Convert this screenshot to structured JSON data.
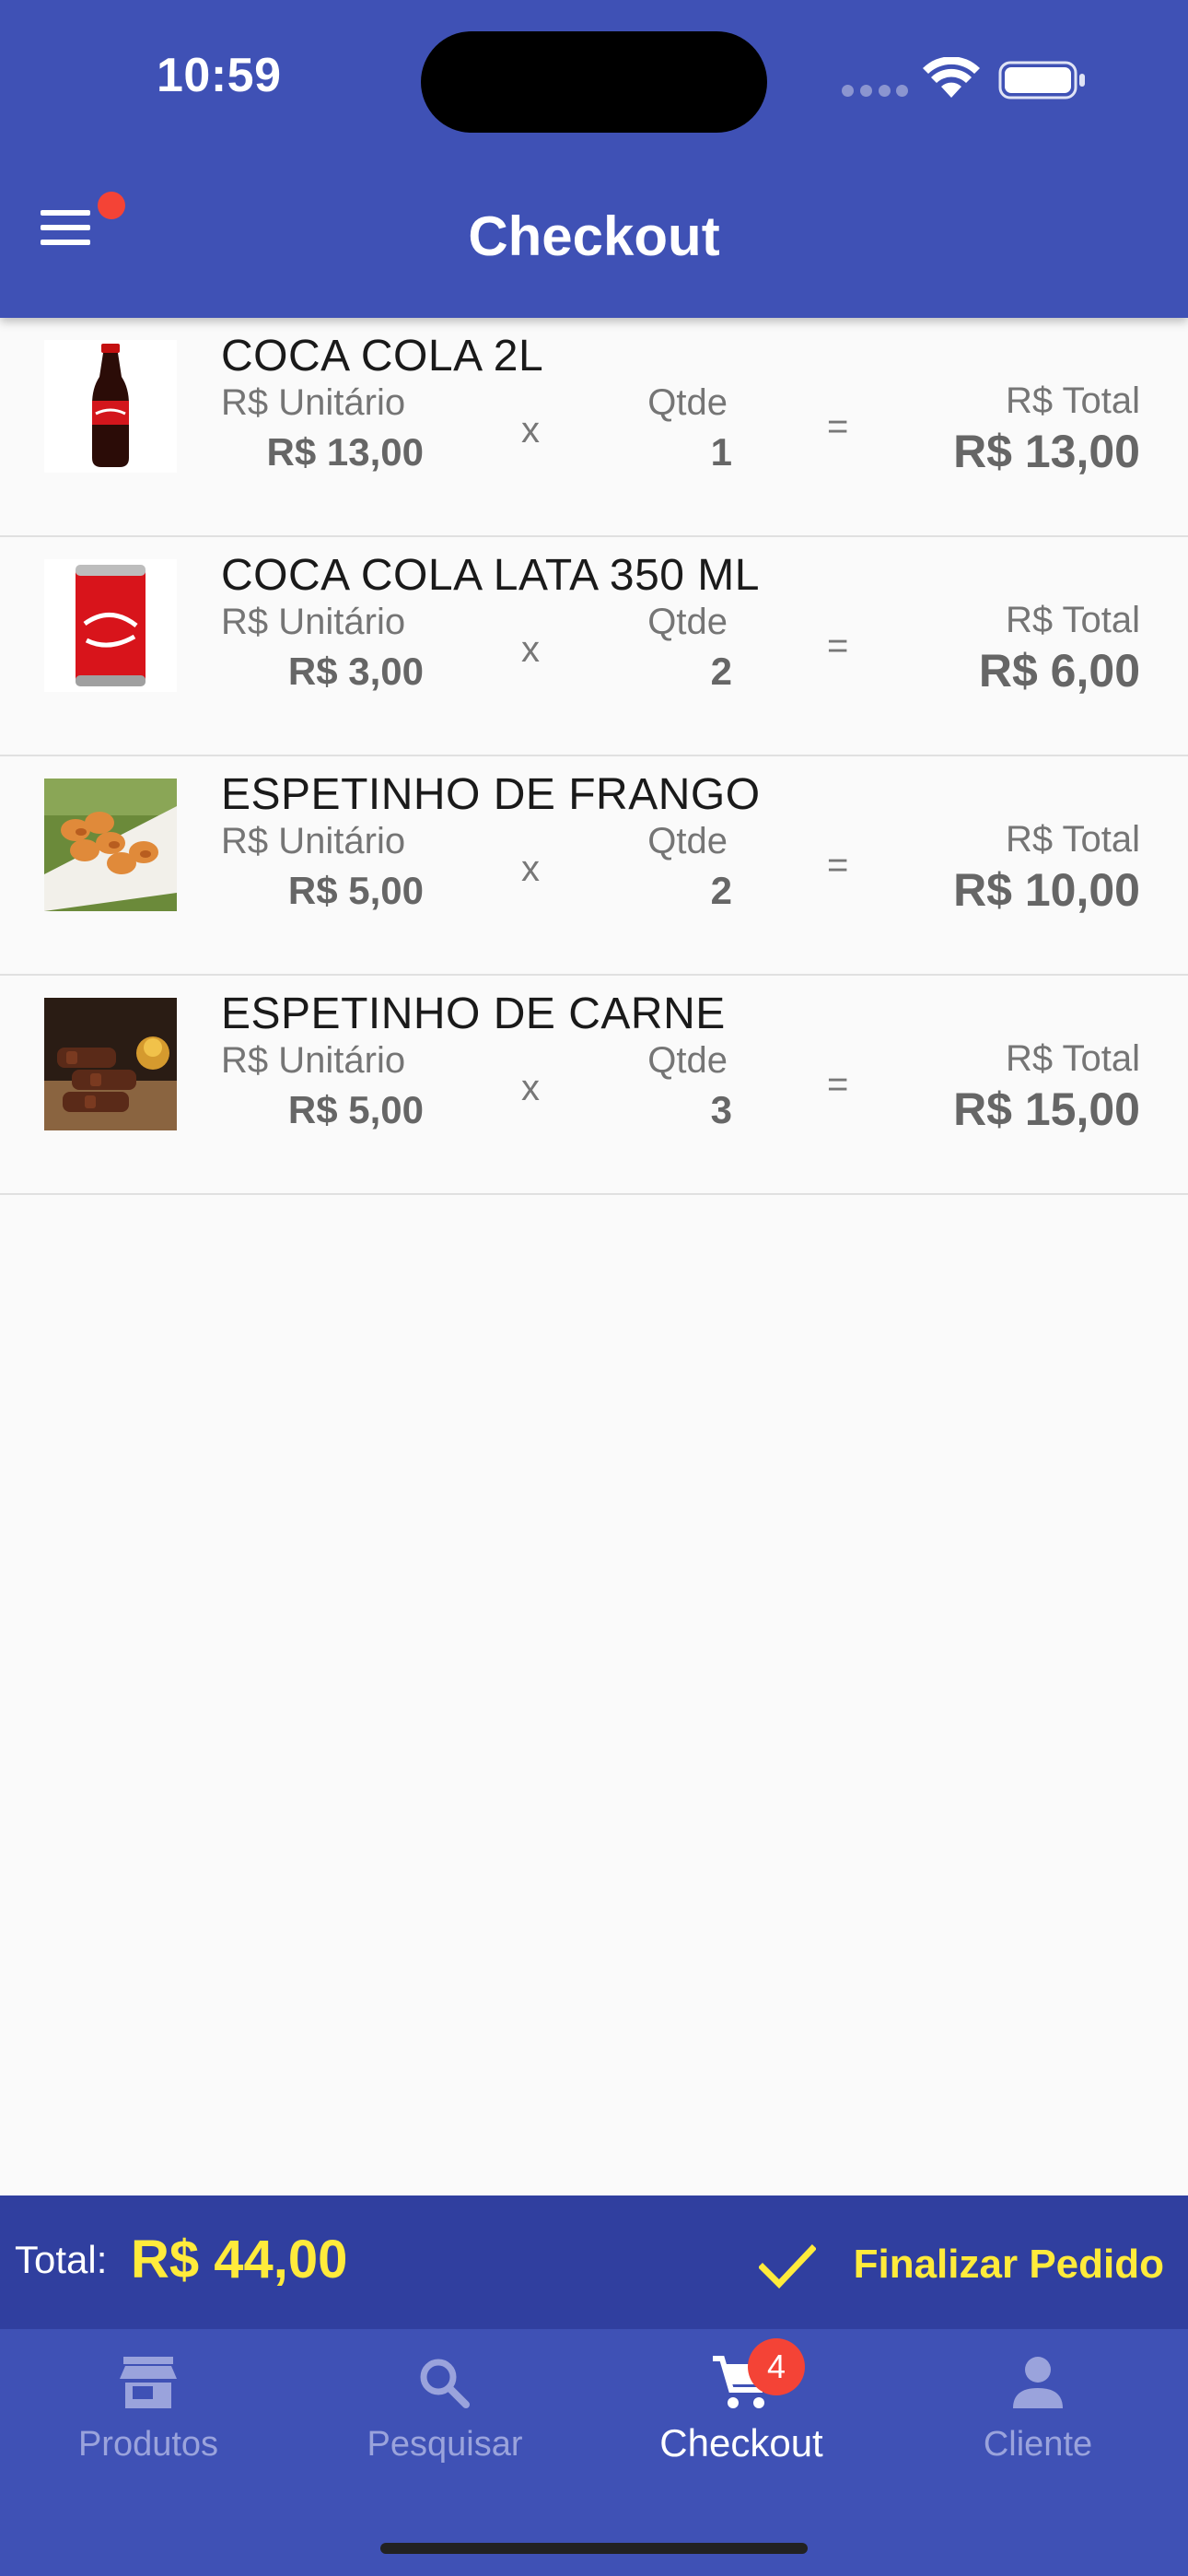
{
  "status_bar": {
    "time": "10:59"
  },
  "header": {
    "title": "Checkout",
    "menu_notification": true
  },
  "labels": {
    "unit_price": "R$ Unitário",
    "qty": "Qtde",
    "total": "R$ Total",
    "times": "x",
    "equals": "="
  },
  "items": [
    {
      "name": "COCA COLA 2L",
      "unit_price": "R$ 13,00",
      "qty": "1",
      "total": "R$ 13,00",
      "image": "coca-cola-2l-bottle"
    },
    {
      "name": "COCA COLA LATA 350 ML",
      "unit_price": "R$ 3,00",
      "qty": "2",
      "total": "R$ 6,00",
      "image": "coca-cola-can"
    },
    {
      "name": "ESPETINHO DE FRANGO",
      "unit_price": "R$ 5,00",
      "qty": "2",
      "total": "R$ 10,00",
      "image": "chicken-skewers"
    },
    {
      "name": "ESPETINHO DE CARNE",
      "unit_price": "R$ 5,00",
      "qty": "3",
      "total": "R$ 15,00",
      "image": "beef-skewers"
    }
  ],
  "footer": {
    "total_label": "Total:",
    "total_value": "R$ 44,00",
    "finalize_label": "Finalizar Pedido"
  },
  "bottom_nav": {
    "items": [
      {
        "label": "Produtos",
        "icon": "store-icon"
      },
      {
        "label": "Pesquisar",
        "icon": "search-icon"
      },
      {
        "label": "Checkout",
        "icon": "cart-icon",
        "active": true
      },
      {
        "label": "Cliente",
        "icon": "person-icon"
      }
    ],
    "cart_badge": "4"
  },
  "colors": {
    "primary": "#3f51b5",
    "primary_dark": "#303f9f",
    "accent_yellow": "#ffeb3b",
    "badge_red": "#f44336"
  }
}
